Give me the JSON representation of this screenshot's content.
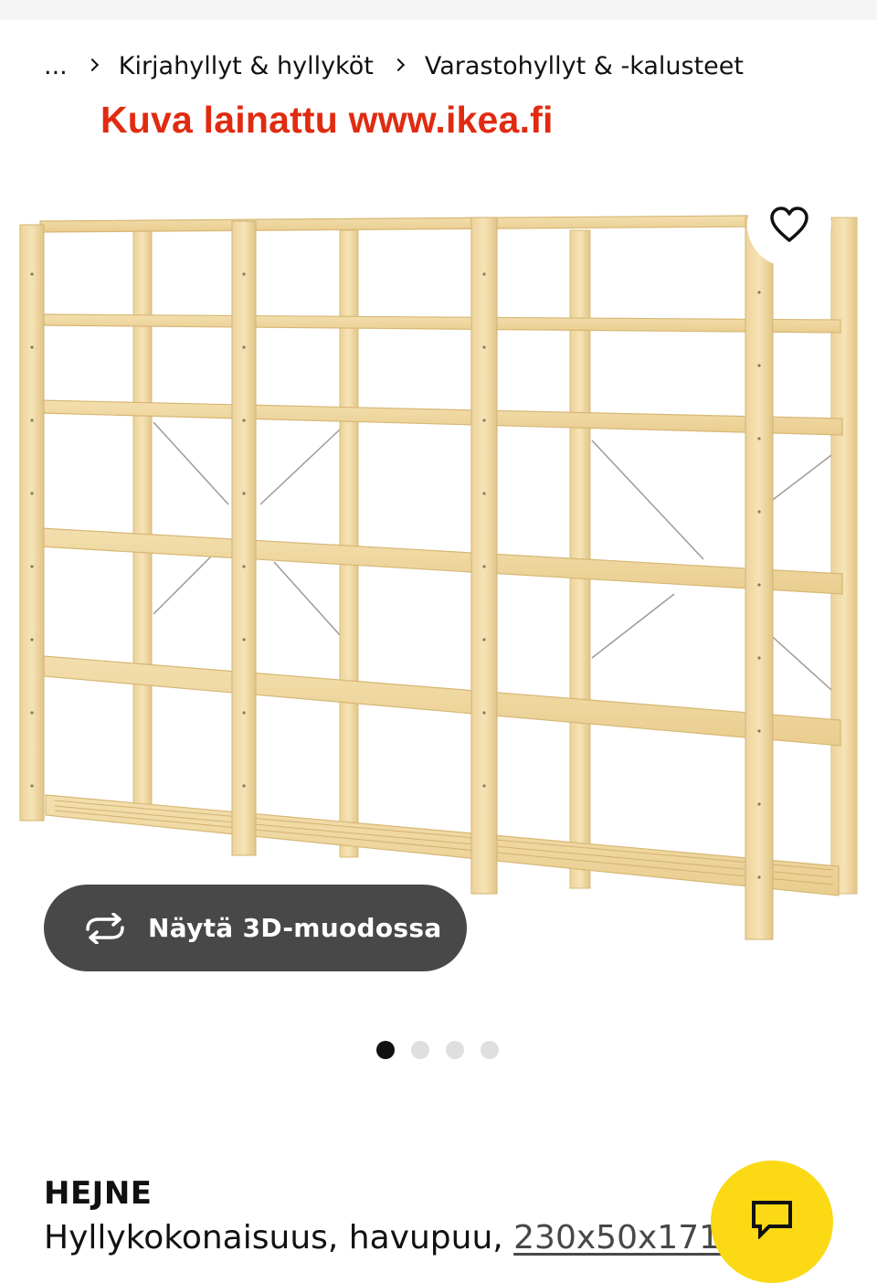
{
  "breadcrumb": {
    "ellipsis": "...",
    "items": [
      {
        "label": "Kirjahyllyt & hyllyköt"
      },
      {
        "label": "Varastohyllyt & -kalusteet"
      }
    ]
  },
  "image_credit": "Kuva lainattu www.ikea.fi",
  "favorite": {
    "icon": "heart-icon"
  },
  "view_3d": {
    "label": "Näytä 3D-muodossa",
    "icon": "rotate-icon"
  },
  "carousel": {
    "total": 4,
    "active_index": 0
  },
  "product": {
    "name": "HEJNE",
    "description": "Hyllykokonaisuus, havupuu, ",
    "size": "230x50x171 cm"
  },
  "chat": {
    "icon": "chat-icon"
  },
  "colors": {
    "credit_red": "#e02b10",
    "button_gray": "#484848",
    "chat_yellow": "#fbd914",
    "wood": "#f0d9a4"
  }
}
